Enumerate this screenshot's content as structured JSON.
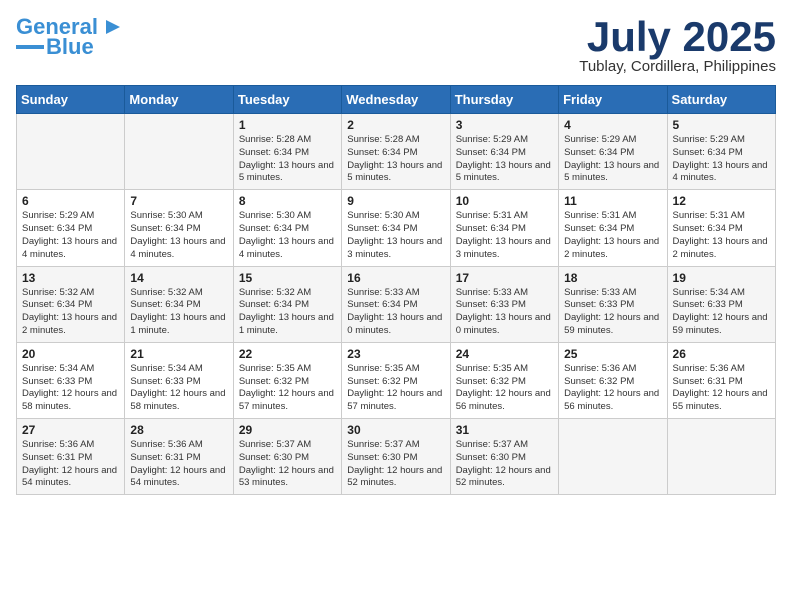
{
  "logo": {
    "line1": "General",
    "line2": "Blue"
  },
  "title": "July 2025",
  "location": "Tublay, Cordillera, Philippines",
  "weekdays": [
    "Sunday",
    "Monday",
    "Tuesday",
    "Wednesday",
    "Thursday",
    "Friday",
    "Saturday"
  ],
  "weeks": [
    [
      {
        "day": "",
        "info": ""
      },
      {
        "day": "",
        "info": ""
      },
      {
        "day": "1",
        "info": "Sunrise: 5:28 AM\nSunset: 6:34 PM\nDaylight: 13 hours and 5 minutes."
      },
      {
        "day": "2",
        "info": "Sunrise: 5:28 AM\nSunset: 6:34 PM\nDaylight: 13 hours and 5 minutes."
      },
      {
        "day": "3",
        "info": "Sunrise: 5:29 AM\nSunset: 6:34 PM\nDaylight: 13 hours and 5 minutes."
      },
      {
        "day": "4",
        "info": "Sunrise: 5:29 AM\nSunset: 6:34 PM\nDaylight: 13 hours and 5 minutes."
      },
      {
        "day": "5",
        "info": "Sunrise: 5:29 AM\nSunset: 6:34 PM\nDaylight: 13 hours and 4 minutes."
      }
    ],
    [
      {
        "day": "6",
        "info": "Sunrise: 5:29 AM\nSunset: 6:34 PM\nDaylight: 13 hours and 4 minutes."
      },
      {
        "day": "7",
        "info": "Sunrise: 5:30 AM\nSunset: 6:34 PM\nDaylight: 13 hours and 4 minutes."
      },
      {
        "day": "8",
        "info": "Sunrise: 5:30 AM\nSunset: 6:34 PM\nDaylight: 13 hours and 4 minutes."
      },
      {
        "day": "9",
        "info": "Sunrise: 5:30 AM\nSunset: 6:34 PM\nDaylight: 13 hours and 3 minutes."
      },
      {
        "day": "10",
        "info": "Sunrise: 5:31 AM\nSunset: 6:34 PM\nDaylight: 13 hours and 3 minutes."
      },
      {
        "day": "11",
        "info": "Sunrise: 5:31 AM\nSunset: 6:34 PM\nDaylight: 13 hours and 2 minutes."
      },
      {
        "day": "12",
        "info": "Sunrise: 5:31 AM\nSunset: 6:34 PM\nDaylight: 13 hours and 2 minutes."
      }
    ],
    [
      {
        "day": "13",
        "info": "Sunrise: 5:32 AM\nSunset: 6:34 PM\nDaylight: 13 hours and 2 minutes."
      },
      {
        "day": "14",
        "info": "Sunrise: 5:32 AM\nSunset: 6:34 PM\nDaylight: 13 hours and 1 minute."
      },
      {
        "day": "15",
        "info": "Sunrise: 5:32 AM\nSunset: 6:34 PM\nDaylight: 13 hours and 1 minute."
      },
      {
        "day": "16",
        "info": "Sunrise: 5:33 AM\nSunset: 6:34 PM\nDaylight: 13 hours and 0 minutes."
      },
      {
        "day": "17",
        "info": "Sunrise: 5:33 AM\nSunset: 6:33 PM\nDaylight: 13 hours and 0 minutes."
      },
      {
        "day": "18",
        "info": "Sunrise: 5:33 AM\nSunset: 6:33 PM\nDaylight: 12 hours and 59 minutes."
      },
      {
        "day": "19",
        "info": "Sunrise: 5:34 AM\nSunset: 6:33 PM\nDaylight: 12 hours and 59 minutes."
      }
    ],
    [
      {
        "day": "20",
        "info": "Sunrise: 5:34 AM\nSunset: 6:33 PM\nDaylight: 12 hours and 58 minutes."
      },
      {
        "day": "21",
        "info": "Sunrise: 5:34 AM\nSunset: 6:33 PM\nDaylight: 12 hours and 58 minutes."
      },
      {
        "day": "22",
        "info": "Sunrise: 5:35 AM\nSunset: 6:32 PM\nDaylight: 12 hours and 57 minutes."
      },
      {
        "day": "23",
        "info": "Sunrise: 5:35 AM\nSunset: 6:32 PM\nDaylight: 12 hours and 57 minutes."
      },
      {
        "day": "24",
        "info": "Sunrise: 5:35 AM\nSunset: 6:32 PM\nDaylight: 12 hours and 56 minutes."
      },
      {
        "day": "25",
        "info": "Sunrise: 5:36 AM\nSunset: 6:32 PM\nDaylight: 12 hours and 56 minutes."
      },
      {
        "day": "26",
        "info": "Sunrise: 5:36 AM\nSunset: 6:31 PM\nDaylight: 12 hours and 55 minutes."
      }
    ],
    [
      {
        "day": "27",
        "info": "Sunrise: 5:36 AM\nSunset: 6:31 PM\nDaylight: 12 hours and 54 minutes."
      },
      {
        "day": "28",
        "info": "Sunrise: 5:36 AM\nSunset: 6:31 PM\nDaylight: 12 hours and 54 minutes."
      },
      {
        "day": "29",
        "info": "Sunrise: 5:37 AM\nSunset: 6:30 PM\nDaylight: 12 hours and 53 minutes."
      },
      {
        "day": "30",
        "info": "Sunrise: 5:37 AM\nSunset: 6:30 PM\nDaylight: 12 hours and 52 minutes."
      },
      {
        "day": "31",
        "info": "Sunrise: 5:37 AM\nSunset: 6:30 PM\nDaylight: 12 hours and 52 minutes."
      },
      {
        "day": "",
        "info": ""
      },
      {
        "day": "",
        "info": ""
      }
    ]
  ]
}
